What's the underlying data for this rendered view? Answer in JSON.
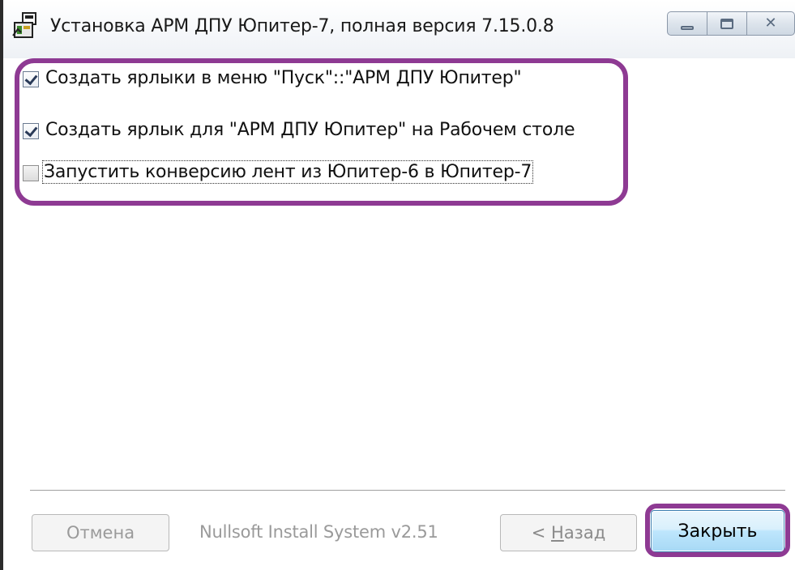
{
  "window": {
    "title": "Установка АРМ ДПУ Юпитер-7, полная версия 7.15.0.8",
    "icon": "installer-icon"
  },
  "caption_buttons": {
    "minimize": "minimize-icon",
    "maximize": "maximize-icon",
    "close": "close-icon",
    "close_glyph": "✕"
  },
  "options": [
    {
      "label": "Создать ярлыки в меню \"Пуск\"::\"АРМ ДПУ Юпитер\"",
      "checked": true
    },
    {
      "label": "Создать ярлык для \"АРМ ДПУ Юпитер\" на Рабочем столе",
      "checked": true
    },
    {
      "label": "Запустить конверсию лент из Юпитер-6 в Юпитер-7",
      "checked": false
    }
  ],
  "footer": {
    "cancel_label": "Отмена",
    "branding": "Nullsoft Install System v2.51",
    "back_prefix": "< ",
    "back_accel": "Н",
    "back_rest": "азад",
    "close_label": "Закрыть"
  },
  "colors": {
    "highlight": "#8e3a93",
    "close_button": "#bee6fd"
  }
}
